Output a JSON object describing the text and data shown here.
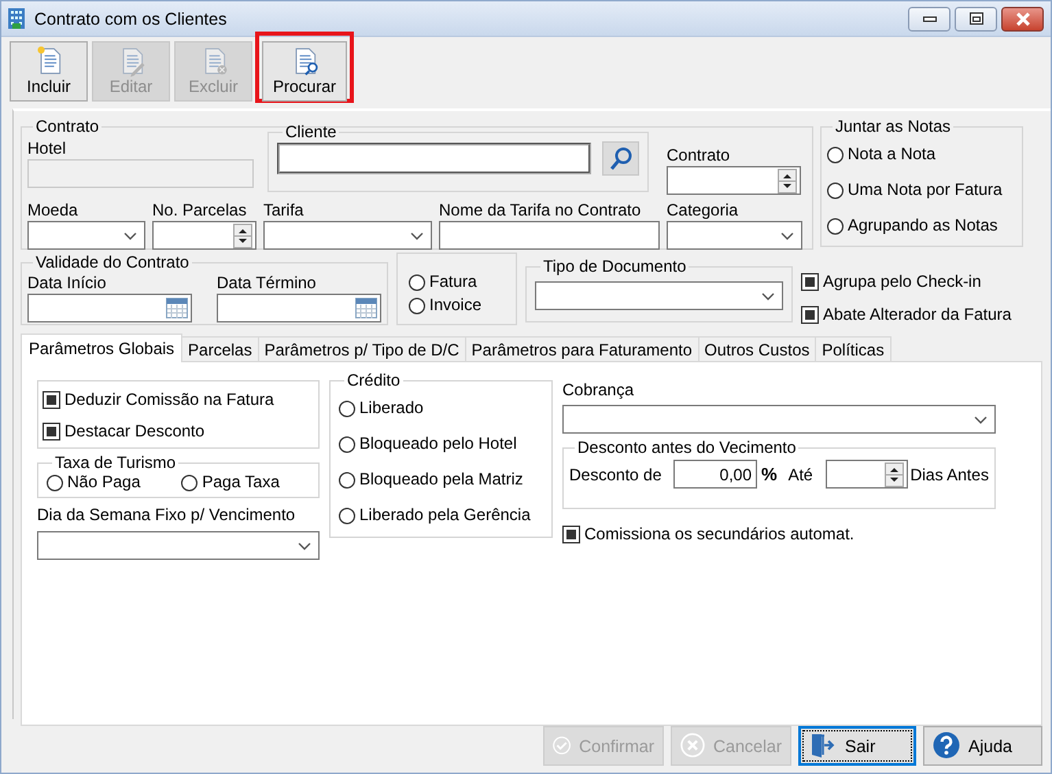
{
  "window": {
    "title": "Contrato com os Clientes"
  },
  "toolbar": [
    {
      "label": "Incluir",
      "kind": "new",
      "disabled": false,
      "highlighted": false
    },
    {
      "label": "Editar",
      "kind": "edit",
      "disabled": true,
      "highlighted": false
    },
    {
      "label": "Excluir",
      "kind": "delete",
      "disabled": true,
      "highlighted": false
    },
    {
      "label": "Procurar",
      "kind": "search",
      "disabled": false,
      "highlighted": true
    }
  ],
  "contrato": {
    "title": "Contrato",
    "hotel": {
      "label": "Hotel",
      "disabled": true
    },
    "cliente": {
      "title": "Cliente"
    },
    "numero": {
      "label": "Contrato"
    },
    "fields": [
      {
        "label": "Moeda",
        "kind": "dropdown"
      },
      {
        "label": "No. Parcelas",
        "kind": "spin"
      },
      {
        "label": "Tarifa",
        "kind": "dropdown"
      },
      {
        "label": "Nome da Tarifa no Contrato",
        "kind": "text"
      },
      {
        "label": "Categoria",
        "kind": "dropdown"
      }
    ]
  },
  "juntar_notas": {
    "title": "Juntar as Notas",
    "options": [
      {
        "label": "Nota a Nota",
        "selected": false
      },
      {
        "label": "Uma Nota por Fatura",
        "selected": false
      },
      {
        "label": "Agrupando as Notas",
        "selected": false
      }
    ]
  },
  "validade": {
    "title": "Validade do Contrato",
    "fields": [
      {
        "label": "Data Início"
      },
      {
        "label": "Data Término"
      }
    ]
  },
  "documento": {
    "options": [
      {
        "label": "Fatura",
        "selected": false
      },
      {
        "label": "Invoice",
        "selected": false
      }
    ]
  },
  "tipo_documento": {
    "title": "Tipo de Documento"
  },
  "checks": [
    {
      "label": "Agrupa pelo Check-in",
      "checked": true
    },
    {
      "label": "Abate Alterador da Fatura",
      "checked": true
    }
  ],
  "tabs": [
    {
      "label": "Parâmetros Globais",
      "selected": true
    },
    {
      "label": "Parcelas",
      "selected": false
    },
    {
      "label": "Parâmetros p/ Tipo de D/C",
      "selected": false
    },
    {
      "label": "Parâmetros para Faturamento",
      "selected": false
    },
    {
      "label": "Outros Custos",
      "selected": false
    },
    {
      "label": "Políticas",
      "selected": false
    }
  ],
  "globais": {
    "checks": [
      {
        "label": "Deduzir Comissão na Fatura",
        "checked": true
      },
      {
        "label": "Destacar Desconto",
        "checked": true
      }
    ],
    "taxa_turismo": {
      "title": "Taxa de Turismo",
      "options": [
        {
          "label": "Não Paga",
          "selected": false
        },
        {
          "label": "Paga Taxa",
          "selected": false
        }
      ]
    },
    "dia_semana": {
      "label": "Dia da Semana Fixo p/ Vencimento"
    },
    "credito": {
      "title": "Crédito",
      "options": [
        {
          "label": "Liberado",
          "selected": false
        },
        {
          "label": "Bloqueado pelo Hotel",
          "selected": false
        },
        {
          "label": "Bloqueado pela Matriz",
          "selected": false
        },
        {
          "label": "Liberado pela Gerência",
          "selected": false
        }
      ]
    },
    "cobranca": {
      "label": "Cobrança"
    },
    "desconto": {
      "title": "Desconto antes do Vecimento",
      "label": "Desconto de",
      "value": "0,00",
      "percent": "%",
      "until": "Até",
      "days": "Dias Antes"
    },
    "comissiona": {
      "label": "Comissiona os secundários automat.",
      "checked": true
    }
  },
  "buttons": [
    {
      "label": "Confirmar",
      "kind": "confirm",
      "disabled": true,
      "focused": false
    },
    {
      "label": "Cancelar",
      "kind": "cancel",
      "disabled": true,
      "focused": false
    },
    {
      "label": "Sair",
      "kind": "exit",
      "disabled": false,
      "focused": true
    },
    {
      "label": "Ajuda",
      "kind": "help",
      "disabled": false,
      "focused": false
    }
  ]
}
